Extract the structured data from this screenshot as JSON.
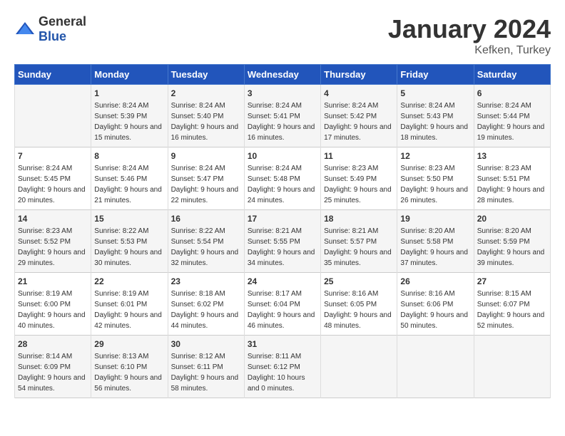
{
  "header": {
    "logo_general": "General",
    "logo_blue": "Blue",
    "month_year": "January 2024",
    "location": "Kefken, Turkey"
  },
  "weekdays": [
    "Sunday",
    "Monday",
    "Tuesday",
    "Wednesday",
    "Thursday",
    "Friday",
    "Saturday"
  ],
  "weeks": [
    [
      {
        "day": "",
        "sunrise": "",
        "sunset": "",
        "daylight": ""
      },
      {
        "day": "1",
        "sunrise": "Sunrise: 8:24 AM",
        "sunset": "Sunset: 5:39 PM",
        "daylight": "Daylight: 9 hours and 15 minutes."
      },
      {
        "day": "2",
        "sunrise": "Sunrise: 8:24 AM",
        "sunset": "Sunset: 5:40 PM",
        "daylight": "Daylight: 9 hours and 16 minutes."
      },
      {
        "day": "3",
        "sunrise": "Sunrise: 8:24 AM",
        "sunset": "Sunset: 5:41 PM",
        "daylight": "Daylight: 9 hours and 16 minutes."
      },
      {
        "day": "4",
        "sunrise": "Sunrise: 8:24 AM",
        "sunset": "Sunset: 5:42 PM",
        "daylight": "Daylight: 9 hours and 17 minutes."
      },
      {
        "day": "5",
        "sunrise": "Sunrise: 8:24 AM",
        "sunset": "Sunset: 5:43 PM",
        "daylight": "Daylight: 9 hours and 18 minutes."
      },
      {
        "day": "6",
        "sunrise": "Sunrise: 8:24 AM",
        "sunset": "Sunset: 5:44 PM",
        "daylight": "Daylight: 9 hours and 19 minutes."
      }
    ],
    [
      {
        "day": "7",
        "sunrise": "Sunrise: 8:24 AM",
        "sunset": "Sunset: 5:45 PM",
        "daylight": "Daylight: 9 hours and 20 minutes."
      },
      {
        "day": "8",
        "sunrise": "Sunrise: 8:24 AM",
        "sunset": "Sunset: 5:46 PM",
        "daylight": "Daylight: 9 hours and 21 minutes."
      },
      {
        "day": "9",
        "sunrise": "Sunrise: 8:24 AM",
        "sunset": "Sunset: 5:47 PM",
        "daylight": "Daylight: 9 hours and 22 minutes."
      },
      {
        "day": "10",
        "sunrise": "Sunrise: 8:24 AM",
        "sunset": "Sunset: 5:48 PM",
        "daylight": "Daylight: 9 hours and 24 minutes."
      },
      {
        "day": "11",
        "sunrise": "Sunrise: 8:23 AM",
        "sunset": "Sunset: 5:49 PM",
        "daylight": "Daylight: 9 hours and 25 minutes."
      },
      {
        "day": "12",
        "sunrise": "Sunrise: 8:23 AM",
        "sunset": "Sunset: 5:50 PM",
        "daylight": "Daylight: 9 hours and 26 minutes."
      },
      {
        "day": "13",
        "sunrise": "Sunrise: 8:23 AM",
        "sunset": "Sunset: 5:51 PM",
        "daylight": "Daylight: 9 hours and 28 minutes."
      }
    ],
    [
      {
        "day": "14",
        "sunrise": "Sunrise: 8:23 AM",
        "sunset": "Sunset: 5:52 PM",
        "daylight": "Daylight: 9 hours and 29 minutes."
      },
      {
        "day": "15",
        "sunrise": "Sunrise: 8:22 AM",
        "sunset": "Sunset: 5:53 PM",
        "daylight": "Daylight: 9 hours and 30 minutes."
      },
      {
        "day": "16",
        "sunrise": "Sunrise: 8:22 AM",
        "sunset": "Sunset: 5:54 PM",
        "daylight": "Daylight: 9 hours and 32 minutes."
      },
      {
        "day": "17",
        "sunrise": "Sunrise: 8:21 AM",
        "sunset": "Sunset: 5:55 PM",
        "daylight": "Daylight: 9 hours and 34 minutes."
      },
      {
        "day": "18",
        "sunrise": "Sunrise: 8:21 AM",
        "sunset": "Sunset: 5:57 PM",
        "daylight": "Daylight: 9 hours and 35 minutes."
      },
      {
        "day": "19",
        "sunrise": "Sunrise: 8:20 AM",
        "sunset": "Sunset: 5:58 PM",
        "daylight": "Daylight: 9 hours and 37 minutes."
      },
      {
        "day": "20",
        "sunrise": "Sunrise: 8:20 AM",
        "sunset": "Sunset: 5:59 PM",
        "daylight": "Daylight: 9 hours and 39 minutes."
      }
    ],
    [
      {
        "day": "21",
        "sunrise": "Sunrise: 8:19 AM",
        "sunset": "Sunset: 6:00 PM",
        "daylight": "Daylight: 9 hours and 40 minutes."
      },
      {
        "day": "22",
        "sunrise": "Sunrise: 8:19 AM",
        "sunset": "Sunset: 6:01 PM",
        "daylight": "Daylight: 9 hours and 42 minutes."
      },
      {
        "day": "23",
        "sunrise": "Sunrise: 8:18 AM",
        "sunset": "Sunset: 6:02 PM",
        "daylight": "Daylight: 9 hours and 44 minutes."
      },
      {
        "day": "24",
        "sunrise": "Sunrise: 8:17 AM",
        "sunset": "Sunset: 6:04 PM",
        "daylight": "Daylight: 9 hours and 46 minutes."
      },
      {
        "day": "25",
        "sunrise": "Sunrise: 8:16 AM",
        "sunset": "Sunset: 6:05 PM",
        "daylight": "Daylight: 9 hours and 48 minutes."
      },
      {
        "day": "26",
        "sunrise": "Sunrise: 8:16 AM",
        "sunset": "Sunset: 6:06 PM",
        "daylight": "Daylight: 9 hours and 50 minutes."
      },
      {
        "day": "27",
        "sunrise": "Sunrise: 8:15 AM",
        "sunset": "Sunset: 6:07 PM",
        "daylight": "Daylight: 9 hours and 52 minutes."
      }
    ],
    [
      {
        "day": "28",
        "sunrise": "Sunrise: 8:14 AM",
        "sunset": "Sunset: 6:09 PM",
        "daylight": "Daylight: 9 hours and 54 minutes."
      },
      {
        "day": "29",
        "sunrise": "Sunrise: 8:13 AM",
        "sunset": "Sunset: 6:10 PM",
        "daylight": "Daylight: 9 hours and 56 minutes."
      },
      {
        "day": "30",
        "sunrise": "Sunrise: 8:12 AM",
        "sunset": "Sunset: 6:11 PM",
        "daylight": "Daylight: 9 hours and 58 minutes."
      },
      {
        "day": "31",
        "sunrise": "Sunrise: 8:11 AM",
        "sunset": "Sunset: 6:12 PM",
        "daylight": "Daylight: 10 hours and 0 minutes."
      },
      {
        "day": "",
        "sunrise": "",
        "sunset": "",
        "daylight": ""
      },
      {
        "day": "",
        "sunrise": "",
        "sunset": "",
        "daylight": ""
      },
      {
        "day": "",
        "sunrise": "",
        "sunset": "",
        "daylight": ""
      }
    ]
  ]
}
